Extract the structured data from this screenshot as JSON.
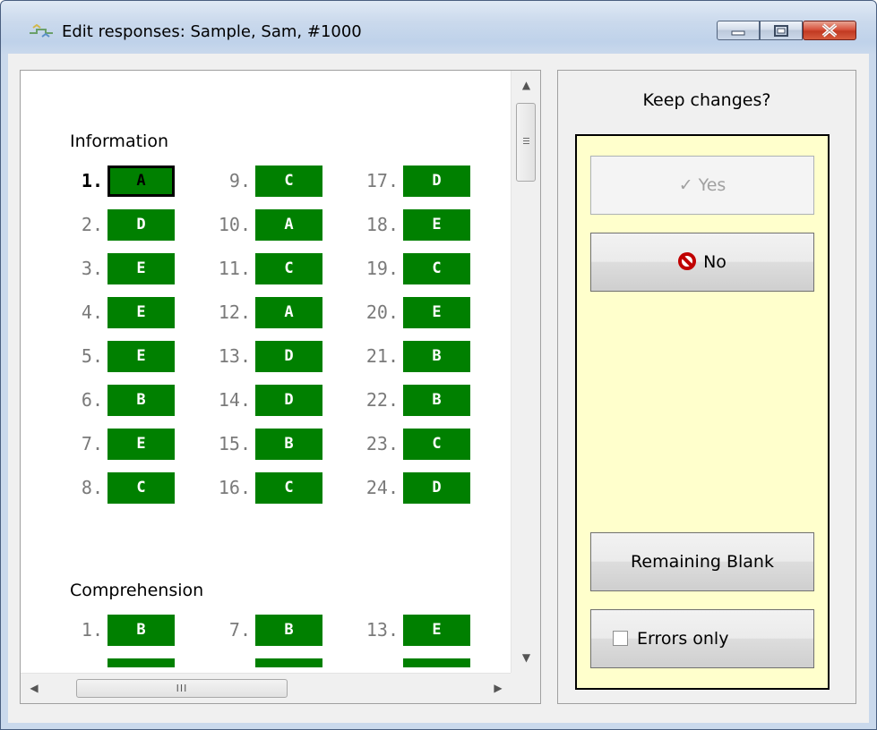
{
  "window": {
    "title": "Edit responses: Sample, Sam, #1000"
  },
  "sections": [
    {
      "title": "Information",
      "columns": [
        [
          {
            "num": "1.",
            "ans": "A",
            "current": true
          },
          {
            "num": "2.",
            "ans": "D"
          },
          {
            "num": "3.",
            "ans": "E"
          },
          {
            "num": "4.",
            "ans": "E"
          },
          {
            "num": "5.",
            "ans": "E"
          },
          {
            "num": "6.",
            "ans": "B"
          },
          {
            "num": "7.",
            "ans": "E"
          },
          {
            "num": "8.",
            "ans": "C"
          }
        ],
        [
          {
            "num": "9.",
            "ans": "C"
          },
          {
            "num": "10.",
            "ans": "A"
          },
          {
            "num": "11.",
            "ans": "C"
          },
          {
            "num": "12.",
            "ans": "A"
          },
          {
            "num": "13.",
            "ans": "D"
          },
          {
            "num": "14.",
            "ans": "D"
          },
          {
            "num": "15.",
            "ans": "B"
          },
          {
            "num": "16.",
            "ans": "C"
          }
        ],
        [
          {
            "num": "17.",
            "ans": "D"
          },
          {
            "num": "18.",
            "ans": "E"
          },
          {
            "num": "19.",
            "ans": "C"
          },
          {
            "num": "20.",
            "ans": "E"
          },
          {
            "num": "21.",
            "ans": "B"
          },
          {
            "num": "22.",
            "ans": "B"
          },
          {
            "num": "23.",
            "ans": "C"
          },
          {
            "num": "24.",
            "ans": "D"
          }
        ]
      ]
    },
    {
      "title": "Comprehension",
      "columns": [
        [
          {
            "num": "1.",
            "ans": "B"
          }
        ],
        [
          {
            "num": "7.",
            "ans": "B"
          }
        ],
        [
          {
            "num": "13.",
            "ans": "E"
          }
        ]
      ]
    }
  ],
  "panel": {
    "prompt": "Keep changes?",
    "yes_label": "Yes",
    "no_label": "No",
    "remaining_label": "Remaining Blank",
    "errors_label": "Errors only",
    "errors_checked": false
  },
  "scrollbars": {
    "h_thumb_grip": "III"
  },
  "colors": {
    "answer_fill": "#008000",
    "panel_bg": "#ffffcc",
    "no_icon": "#c00000"
  }
}
